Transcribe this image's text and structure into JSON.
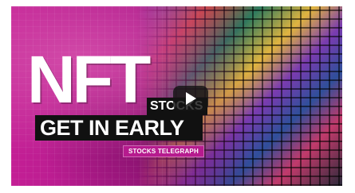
{
  "video": {
    "title_big": "NFT",
    "stocks_tag": "STOCKS",
    "headline": "GET IN EARLY",
    "source_badge": "STOCKS TELEGRAPH"
  },
  "icons": {
    "play": "play-icon"
  },
  "colors": {
    "accent_magenta": "#b0158f",
    "bar_black": "#111111",
    "text_white": "#ffffff"
  }
}
